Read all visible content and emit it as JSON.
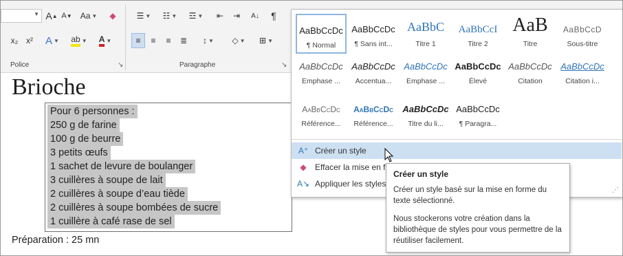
{
  "ribbon": {
    "font_group_label": "Police",
    "paragraph_group_label": "Paragraphe",
    "font_buttons": {
      "grow_font": "A",
      "shrink_font": "A",
      "change_case": "Aa",
      "subscript": "x₂",
      "superscript": "x²",
      "text_effects": "A",
      "highlight": "ab",
      "font_color": "A"
    },
    "paragraph_buttons": {
      "sort": "A↓",
      "show_marks": "¶"
    },
    "colors": {
      "highlight_bar": "#f2e600",
      "font_color_bar": "#d21f1f",
      "text_effects": "#3a78c9"
    }
  },
  "styles_gallery": {
    "rows": [
      [
        {
          "preview": "AaBbCcDc",
          "caption": "¶ Normal",
          "selected": true
        },
        {
          "preview": "AaBbCcDc",
          "caption": "¶ Sans int..."
        },
        {
          "preview": "AaBbC",
          "caption": "Titre 1"
        },
        {
          "preview": "AaBbCcI",
          "caption": "Titre 2"
        },
        {
          "preview": "AaB",
          "caption": "Titre"
        },
        {
          "preview": "AaBbCcD",
          "caption": "Sous-titre"
        }
      ],
      [
        {
          "preview": "AaBbCcDc",
          "caption": "Emphase ..."
        },
        {
          "preview": "AaBbCcDc",
          "caption": "Accentua..."
        },
        {
          "preview": "AaBbCcDc",
          "caption": "Emphase ..."
        },
        {
          "preview": "AaBbCcDc",
          "caption": "Élevé"
        },
        {
          "preview": "AaBbCcDc",
          "caption": "Citation"
        },
        {
          "preview": "AaBbCcDc",
          "caption": "Citation i..."
        }
      ],
      [
        {
          "preview": "AaBbCcDc",
          "caption": "Référence..."
        },
        {
          "preview": "AaBbCcDc",
          "caption": "Référence..."
        },
        {
          "preview": "AaBbCcDc",
          "caption": "Titre du li..."
        },
        {
          "preview": "AaBbCcDc",
          "caption": "¶ Paragra..."
        }
      ]
    ],
    "menu": {
      "create_style": "Créer un style",
      "clear_formatting": "Effacer la mise en forme",
      "apply_styles": "Appliquer les styles..."
    }
  },
  "tooltip": {
    "title": "Créer un style",
    "para1": "Créer un style basé sur la mise en forme du texte sélectionné.",
    "para2": "Nous stockerons votre création dans la bibliothèque de styles pour vous permettre de la réutiliser facilement."
  },
  "document": {
    "title": "Brioche",
    "ingredients": [
      "Pour 6 personnes :",
      "250 g de farine",
      "100 g de beurre",
      "3 petits œufs",
      "1 sachet de levure de boulanger",
      "3 cuillères à soupe de lait",
      "2 cuillères à soupe d’eau tiède",
      "2 cuillères à soupe bombées de sucre",
      "1 cuillère à café rase de sel"
    ],
    "preparation": "Préparation : 25 mn"
  },
  "colors": {
    "selection_gray": "#c6c6c6",
    "menu_highlight": "#cde0f2",
    "heading_blue": "#2e74b5"
  }
}
